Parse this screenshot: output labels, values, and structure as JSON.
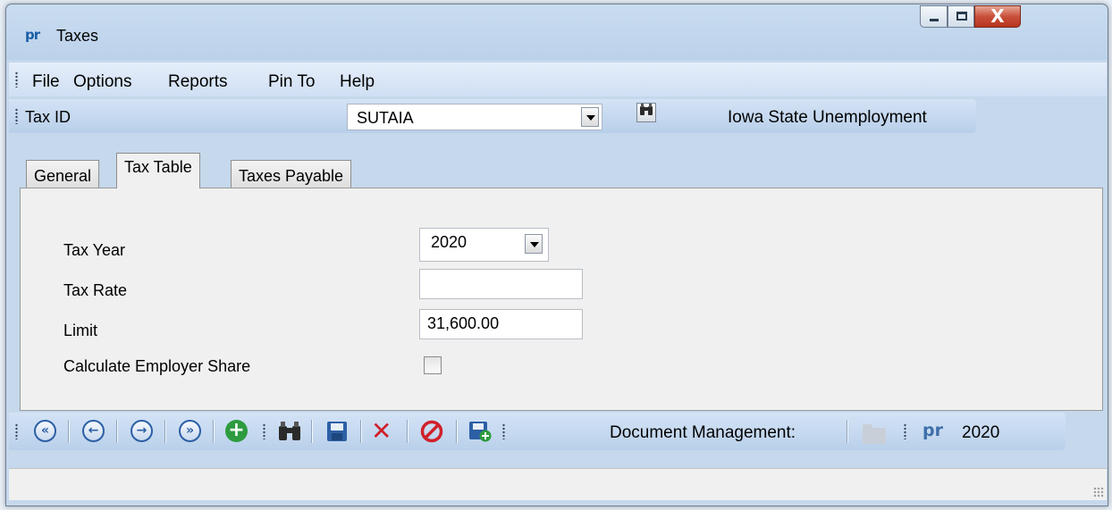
{
  "window": {
    "app_icon": "pr",
    "title": "Taxes",
    "close_glyph": "X"
  },
  "menu": {
    "items": [
      "File",
      "Options",
      "Reports",
      "Pin To",
      "Help"
    ]
  },
  "tax_id": {
    "label": "Tax ID",
    "value": "SUTAIA",
    "description": "Iowa State Unemployment",
    "find_icon": "binoculars-icon"
  },
  "tabs": [
    {
      "label": "General",
      "active": false
    },
    {
      "label": "Tax Table",
      "active": true
    },
    {
      "label": "Taxes Payable",
      "active": false
    }
  ],
  "form": {
    "tax_year_label": "Tax Year",
    "tax_year_value": "2020",
    "tax_rate_label": "Tax Rate",
    "tax_rate_value": "",
    "limit_label": "Limit",
    "limit_value": "31,600.00",
    "employer_share_label": "Calculate Employer Share",
    "employer_share_checked": false
  },
  "toolbar": {
    "icons": [
      "first-record-icon",
      "previous-record-icon",
      "next-record-icon",
      "last-record-icon",
      "add-record-icon",
      "find-icon",
      "save-icon",
      "delete-icon",
      "cancel-icon",
      "save-new-icon"
    ],
    "document_management_label": "Document Management:",
    "folder_icon": "folder-icon",
    "pr_icon": "pr",
    "year": "2020"
  },
  "colors": {
    "nav_blue": "#2c5fa5",
    "add_green": "#2e9b3f",
    "delete_red": "#d0202a"
  }
}
